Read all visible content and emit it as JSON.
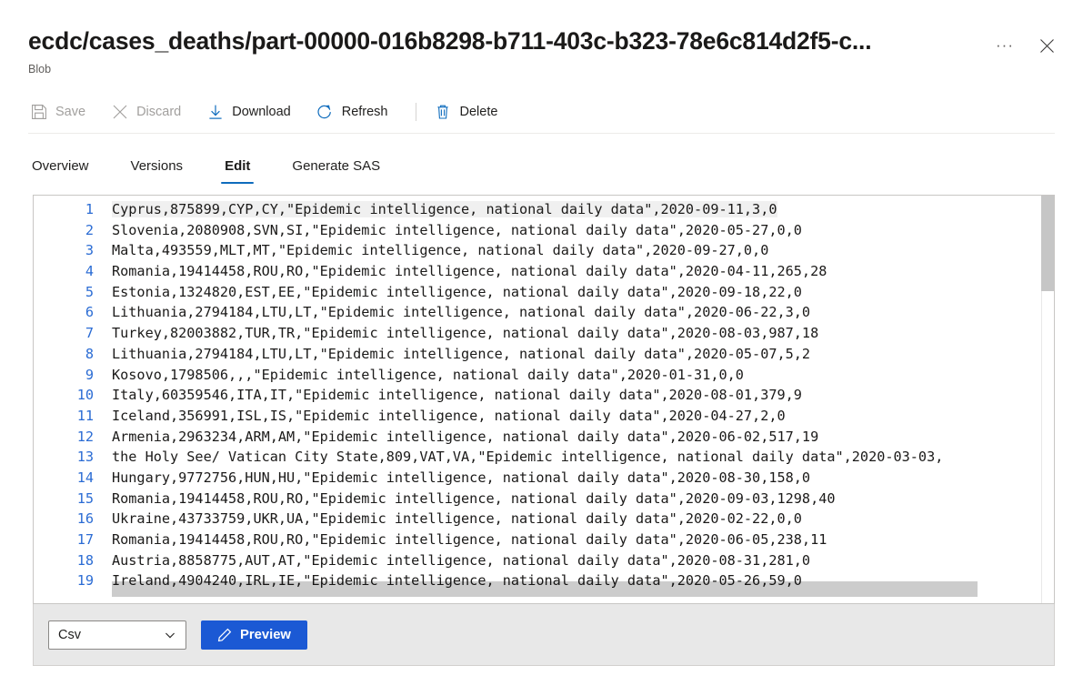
{
  "header": {
    "title": "ecdc/cases_deaths/part-00000-016b8298-b711-403c-b323-78e6c814d2f5-c...",
    "subtitle": "Blob",
    "more_icon": "···",
    "close_icon": "close-icon"
  },
  "commands": [
    {
      "label": "Save",
      "icon": "save-icon",
      "enabled": false
    },
    {
      "label": "Discard",
      "icon": "discard-icon",
      "enabled": false
    },
    {
      "label": "Download",
      "icon": "download-icon",
      "enabled": true
    },
    {
      "label": "Refresh",
      "icon": "refresh-icon",
      "enabled": true
    },
    {
      "label": "Delete",
      "icon": "delete-icon",
      "enabled": true
    }
  ],
  "tabs": [
    {
      "label": "Overview",
      "active": false
    },
    {
      "label": "Versions",
      "active": false
    },
    {
      "label": "Edit",
      "active": true
    },
    {
      "label": "Generate SAS",
      "active": false
    }
  ],
  "editor": {
    "lines": [
      {
        "n": "1",
        "text": "Cyprus,875899,CYP,CY,\"Epidemic intelligence, national daily data\",2020-09-11,3,0"
      },
      {
        "n": "2",
        "text": "Slovenia,2080908,SVN,SI,\"Epidemic intelligence, national daily data\",2020-05-27,0,0"
      },
      {
        "n": "3",
        "text": "Malta,493559,MLT,MT,\"Epidemic intelligence, national daily data\",2020-09-27,0,0"
      },
      {
        "n": "4",
        "text": "Romania,19414458,ROU,RO,\"Epidemic intelligence, national daily data\",2020-04-11,265,28"
      },
      {
        "n": "5",
        "text": "Estonia,1324820,EST,EE,\"Epidemic intelligence, national daily data\",2020-09-18,22,0"
      },
      {
        "n": "6",
        "text": "Lithuania,2794184,LTU,LT,\"Epidemic intelligence, national daily data\",2020-06-22,3,0"
      },
      {
        "n": "7",
        "text": "Turkey,82003882,TUR,TR,\"Epidemic intelligence, national daily data\",2020-08-03,987,18"
      },
      {
        "n": "8",
        "text": "Lithuania,2794184,LTU,LT,\"Epidemic intelligence, national daily data\",2020-05-07,5,2"
      },
      {
        "n": "9",
        "text": "Kosovo,1798506,,,\"Epidemic intelligence, national daily data\",2020-01-31,0,0"
      },
      {
        "n": "10",
        "text": "Italy,60359546,ITA,IT,\"Epidemic intelligence, national daily data\",2020-08-01,379,9"
      },
      {
        "n": "11",
        "text": "Iceland,356991,ISL,IS,\"Epidemic intelligence, national daily data\",2020-04-27,2,0"
      },
      {
        "n": "12",
        "text": "Armenia,2963234,ARM,AM,\"Epidemic intelligence, national daily data\",2020-06-02,517,19"
      },
      {
        "n": "13",
        "text": "the Holy See/ Vatican City State,809,VAT,VA,\"Epidemic intelligence, national daily data\",2020-03-03,"
      },
      {
        "n": "14",
        "text": "Hungary,9772756,HUN,HU,\"Epidemic intelligence, national daily data\",2020-08-30,158,0"
      },
      {
        "n": "15",
        "text": "Romania,19414458,ROU,RO,\"Epidemic intelligence, national daily data\",2020-09-03,1298,40"
      },
      {
        "n": "16",
        "text": "Ukraine,43733759,UKR,UA,\"Epidemic intelligence, national daily data\",2020-02-22,0,0"
      },
      {
        "n": "17",
        "text": "Romania,19414458,ROU,RO,\"Epidemic intelligence, national daily data\",2020-06-05,238,11"
      },
      {
        "n": "18",
        "text": "Austria,8858775,AUT,AT,\"Epidemic intelligence, national daily data\",2020-08-31,281,0"
      },
      {
        "n": "19",
        "text": "Ireland,4904240,IRL,IE,\"Epidemic intelligence, national daily data\",2020-05-26,59,0"
      }
    ]
  },
  "footer": {
    "format_value": "Csv",
    "preview_label": "Preview",
    "preview_icon": "pencil-icon",
    "chevron_icon": "chevron-down-icon"
  },
  "colors": {
    "accent": "#0f6cbd",
    "primary_button": "#1b59d4",
    "line_number": "#2b6cd4",
    "disabled_text": "#a19f9d"
  }
}
